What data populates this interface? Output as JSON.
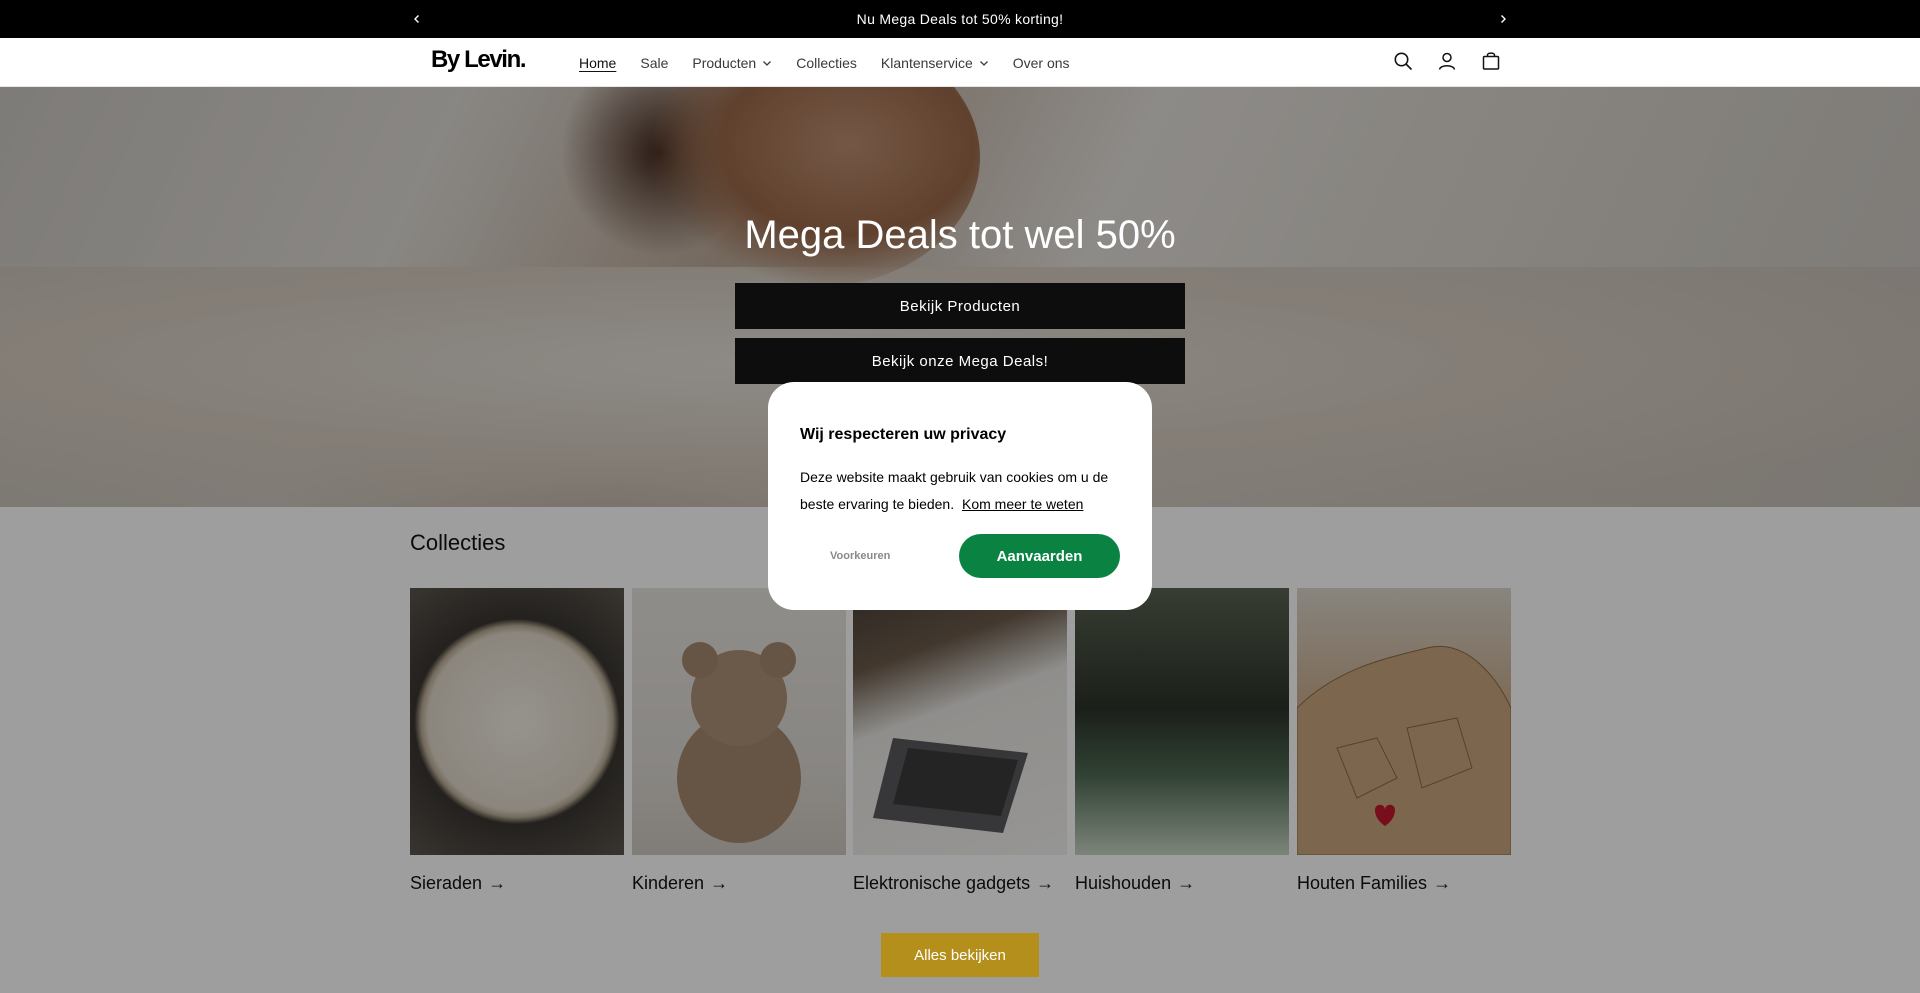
{
  "announcement": {
    "text": "Nu Mega Deals tot 50% korting!"
  },
  "header": {
    "logo": "By Levin.",
    "nav": [
      {
        "label": "Home",
        "active": true,
        "dropdown": false
      },
      {
        "label": "Sale",
        "dropdown": false
      },
      {
        "label": "Producten",
        "dropdown": true
      },
      {
        "label": "Collecties",
        "dropdown": false
      },
      {
        "label": "Klantenservice",
        "dropdown": true
      },
      {
        "label": "Over ons",
        "dropdown": false
      }
    ],
    "icons": [
      "search-icon",
      "account-icon",
      "cart-icon"
    ]
  },
  "hero": {
    "title": "Mega Deals tot wel 50%",
    "button1": "Bekijk Producten",
    "button2": "Bekijk onze Mega Deals!"
  },
  "collections": {
    "heading": "Collecties",
    "items": [
      {
        "label": "Sieraden"
      },
      {
        "label": "Kinderen"
      },
      {
        "label": "Elektronische gadgets"
      },
      {
        "label": "Huishouden"
      },
      {
        "label": "Houten Families"
      }
    ],
    "view_all": "Alles bekijken"
  },
  "cookie_modal": {
    "title": "Wij respecteren uw privacy",
    "text": "Deze website maakt gebruik van cookies om u de beste ervaring te bieden.",
    "link": "Kom meer te weten",
    "preferences": "Voorkeuren",
    "accept": "Aanvaarden",
    "accept_color": "#0a8342"
  },
  "colors": {
    "view_all_button": "#b48f1b",
    "announcement_bg": "#000000"
  }
}
